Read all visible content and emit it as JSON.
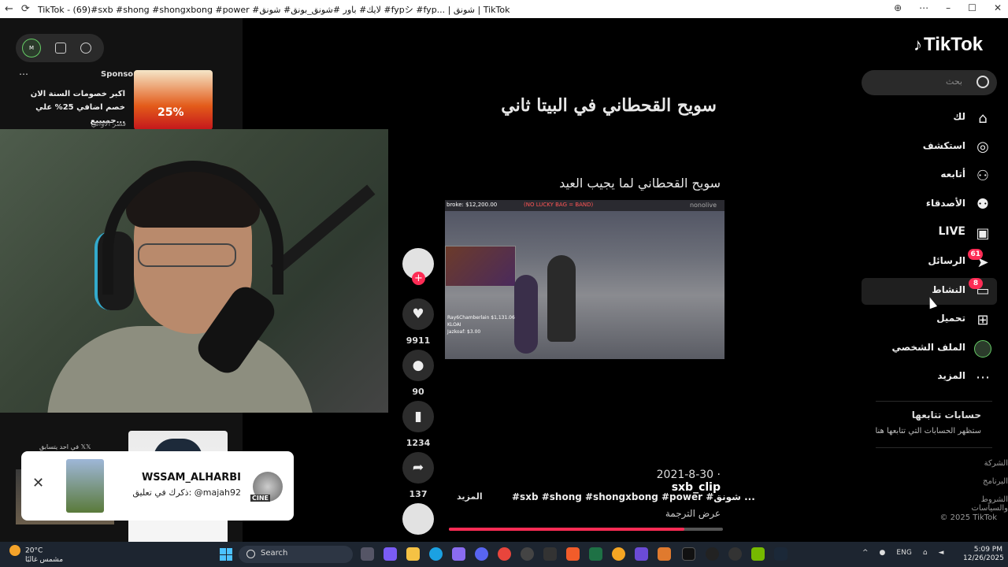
{
  "browser": {
    "title": "TikTok - (69)#sxb #shong #shongxbong #power #لايك# باور #شونق_بونق# شونق #fypシ #fyp... | شونق | TikTok"
  },
  "left": {
    "ad": {
      "sponsored": "Sponsored",
      "text": "اكبر خصومات السنة الان خصم اضافي 25% علي جميييع...",
      "source": "قصر الاواني",
      "badge": "25%"
    },
    "thumb_caption": "في احد يتسابق 𝕏𝕏",
    "notification": {
      "name": "WSSAM_ALHARBI",
      "message": "ذكرك في تعليق: @majah92",
      "tag": "CINE"
    }
  },
  "video": {
    "big_title": "سويح القحطاني في البيتا ثاني",
    "subtitle": "سويح القحطاني لما يجيب العيد",
    "overlay_left": "broke: $12,200.00",
    "overlay_center": "(NO LUCKY BAG = BAND)",
    "overlay_brand": "nonolive",
    "overlay_stats": [
      "Ray6Chamberlain $1,131.06",
      "KLOAI",
      "Jazkoaf: $3.00"
    ],
    "likes": "9911",
    "comments": "90",
    "saves": "1234",
    "shares": "137",
    "author": "sxb_clip",
    "date": "2021-8-30",
    "hashtags": "#sxb #shong #shongxbong #power #شونق ...",
    "more": "المزيد",
    "translate": "عرض الترجمة",
    "progress": 0.86
  },
  "sidebar": {
    "logo": "TikTok",
    "search_placeholder": "بحث",
    "items": [
      {
        "label": "لك",
        "icon": "home-icon"
      },
      {
        "label": "استكشف",
        "icon": "compass-icon"
      },
      {
        "label": "أتابعه",
        "icon": "user-follow-icon"
      },
      {
        "label": "الأصدقاء",
        "icon": "friends-icon"
      },
      {
        "label": "LIVE",
        "icon": "live-tv-icon"
      },
      {
        "label": "الرسائل",
        "icon": "send-icon",
        "badge": "61"
      },
      {
        "label": "النشاط",
        "icon": "inbox-icon",
        "badge": "8"
      },
      {
        "label": "تحميل",
        "icon": "plus-square-icon"
      },
      {
        "label": "الملف الشخصي",
        "icon": "profile-avatar-icon"
      },
      {
        "label": "المزيد",
        "icon": "more-dots-icon"
      }
    ],
    "following_heading": "حسابات تتابعها",
    "following_sub": "ستظهر الحسابات التي تتابعها هنا",
    "footer": [
      "الشركة",
      "البرنامج",
      "الشروط والسياسات",
      "© 2025 TikTok"
    ]
  },
  "taskbar": {
    "temp": "20°C",
    "weather": "مشمس غالبًا",
    "search": "Search",
    "lang": "ENG",
    "time": "5:09 PM",
    "date": "12/26/2025"
  }
}
